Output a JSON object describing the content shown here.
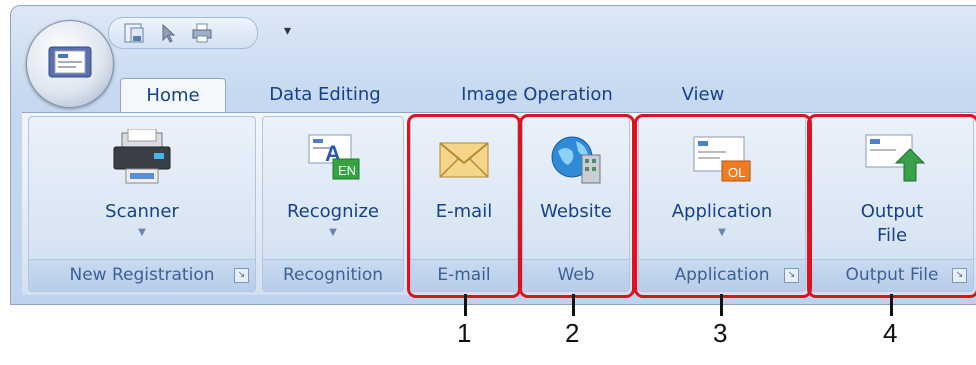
{
  "tabs": [
    "Home",
    "Data Editing",
    "Image Operation",
    "View"
  ],
  "groups": {
    "new_registration": {
      "button": "Scanner",
      "caption": "New Registration"
    },
    "recognition": {
      "button": "Recognize",
      "caption": "Recognition",
      "icon_text": "EN"
    },
    "email": {
      "button": "E-mail",
      "caption": "E-mail"
    },
    "web": {
      "button": "Website",
      "caption": "Web"
    },
    "application": {
      "button": "Application",
      "caption": "Application",
      "icon_text": "OL"
    },
    "output_file": {
      "button_line1": "Output",
      "button_line2": "File",
      "caption": "Output File"
    }
  },
  "qat": {
    "dropdown_glyph": "▾"
  },
  "callouts": [
    "1",
    "2",
    "3",
    "4"
  ],
  "colors": {
    "accent_red": "#e0101e"
  }
}
